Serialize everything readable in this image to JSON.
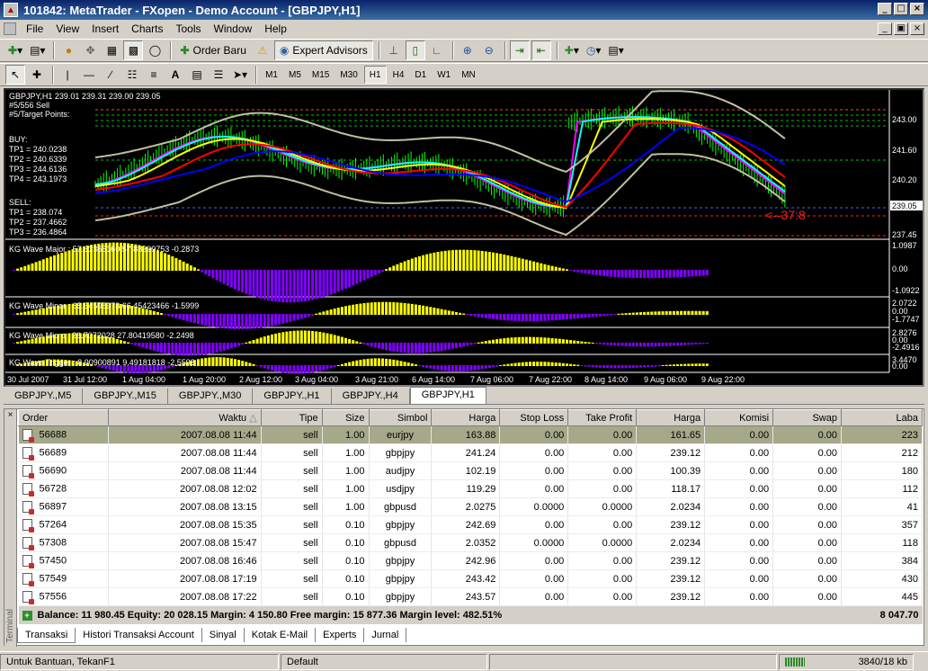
{
  "window": {
    "title": "101842: MetaTrader - FXopen - Demo Account - [GBPJPY,H1]"
  },
  "menu": [
    "File",
    "View",
    "Insert",
    "Charts",
    "Tools",
    "Window",
    "Help"
  ],
  "toolbar1": {
    "order_label": "Order Baru",
    "ea_label": "Expert Advisors"
  },
  "timeframes": [
    "M1",
    "M5",
    "M15",
    "M30",
    "H1",
    "H4",
    "D1",
    "W1",
    "MN"
  ],
  "active_timeframe": "H1",
  "chart": {
    "header": "GBPJPY,H1  239.01 239.31 239.00 239.05",
    "sell_line": "#5/556 Sell",
    "target_points": "#5/Target Points:",
    "buy_block": {
      "label": "BUY:",
      "tp1": "TP1 = 240.0238",
      "tp2": "TP2 = 240.6339",
      "tp3": "TP3 = 244.6136",
      "tp4": "TP4 = 243.1973"
    },
    "sell_block": {
      "label": "SELL:",
      "tp1": "TP1 = 238.074",
      "tp2": "TP2 = 237.4662",
      "tp3": "TP3 = 236.4864"
    },
    "price_labels": [
      "243.00",
      "241.60",
      "240.20",
      "239.05",
      "237.45"
    ],
    "counter": "<--37:8",
    "indicators": [
      {
        "name": "KG Wave Major : 57.61365160 57.83399753 -0.2873",
        "scale": [
          "1.0987",
          "0.00",
          "-1.0922"
        ]
      },
      {
        "name": "KG Wave Minor : 65.64508978 66.45423466 -1.5999",
        "scale": [
          "2.0722",
          "0.00",
          "-1.7747"
        ]
      },
      {
        "name": "KG Wave Micro : 26.7072028 27.80419580 -2.2498",
        "scale": [
          "2.8276",
          "0.00",
          "-2.4916"
        ]
      },
      {
        "name": "KG Wave Trigger : 8.90900891 9.49181818 -2.5598",
        "scale": [
          "3.4470",
          "0.00"
        ]
      }
    ],
    "time_labels": [
      "30 Jul 2007",
      "31 Jul 12:00",
      "1 Aug 04:00",
      "1 Aug 20:00",
      "2 Aug 12:00",
      "3 Aug 04:00",
      "3 Aug 21:00",
      "6 Aug 14:00",
      "7 Aug 06:00",
      "7 Aug 22:00",
      "8 Aug 14:00",
      "9 Aug 06:00",
      "9 Aug 22:00"
    ],
    "colors": {
      "bull": "#00ff00",
      "ma_yellow": "#ffff00",
      "ma_red": "#ff0000",
      "ma_blue": "#0000ff",
      "ma_magenta": "#ff00ff",
      "ma_cyan": "#00ffff",
      "ind_purple": "#8000ff",
      "ind_yellow": "#ffff00"
    }
  },
  "chart_tabs": [
    "GBPJPY.,M5",
    "GBPJPY.,M15",
    "GBPJPY.,M30",
    "GBPJPY.,H1",
    "GBPJPY.,H4",
    "GBPJPY,H1"
  ],
  "active_chart_tab": "GBPJPY,H1",
  "terminal": {
    "columns": [
      "Order",
      "Waktu",
      "Tipe",
      "Size",
      "Simbol",
      "Harga",
      "Stop Loss",
      "Take Profit",
      "Harga",
      "Komisi",
      "Swap",
      "Laba"
    ],
    "rows": [
      [
        "56688",
        "2007.08.08 11:44",
        "sell",
        "1.00",
        "eurjpy",
        "163.88",
        "0.00",
        "0.00",
        "161.65",
        "0.00",
        "0.00",
        "223"
      ],
      [
        "56689",
        "2007.08.08 11:44",
        "sell",
        "1.00",
        "gbpjpy",
        "241.24",
        "0.00",
        "0.00",
        "239.12",
        "0.00",
        "0.00",
        "212"
      ],
      [
        "56690",
        "2007.08.08 11:44",
        "sell",
        "1.00",
        "audjpy",
        "102.19",
        "0.00",
        "0.00",
        "100.39",
        "0.00",
        "0.00",
        "180"
      ],
      [
        "56728",
        "2007.08.08 12:02",
        "sell",
        "1.00",
        "usdjpy",
        "119.29",
        "0.00",
        "0.00",
        "118.17",
        "0.00",
        "0.00",
        "112"
      ],
      [
        "56897",
        "2007.08.08 13:15",
        "sell",
        "1.00",
        "gbpusd",
        "2.0275",
        "0.0000",
        "0.0000",
        "2.0234",
        "0.00",
        "0.00",
        "41"
      ],
      [
        "57264",
        "2007.08.08 15:35",
        "sell",
        "0.10",
        "gbpjpy",
        "242.69",
        "0.00",
        "0.00",
        "239.12",
        "0.00",
        "0.00",
        "357"
      ],
      [
        "57308",
        "2007.08.08 15:47",
        "sell",
        "0.10",
        "gbpusd",
        "2.0352",
        "0.0000",
        "0.0000",
        "2.0234",
        "0.00",
        "0.00",
        "118"
      ],
      [
        "57450",
        "2007.08.08 16:46",
        "sell",
        "0.10",
        "gbpjpy",
        "242.96",
        "0.00",
        "0.00",
        "239.12",
        "0.00",
        "0.00",
        "384"
      ],
      [
        "57549",
        "2007.08.08 17:19",
        "sell",
        "0.10",
        "gbpjpy",
        "243.42",
        "0.00",
        "0.00",
        "239.12",
        "0.00",
        "0.00",
        "430"
      ],
      [
        "57556",
        "2007.08.08 17:22",
        "sell",
        "0.10",
        "gbpjpy",
        "243.57",
        "0.00",
        "0.00",
        "239.12",
        "0.00",
        "0.00",
        "445"
      ]
    ],
    "summary": "Balance: 11 980.45  Equity: 20 028.15  Margin: 4 150.80  Free margin: 15 877.36  Margin level: 482.51%",
    "total": "8 047.70",
    "side_label": "Terminal"
  },
  "terminal_tabs": [
    "Transaksi",
    "Histori Transaksi Account",
    "Sinyal",
    "Kotak E-Mail",
    "Experts",
    "Jurnal"
  ],
  "status": {
    "help": "Untuk Bantuan, TekanF1",
    "profile": "Default",
    "traffic": "3840/18 kb"
  }
}
